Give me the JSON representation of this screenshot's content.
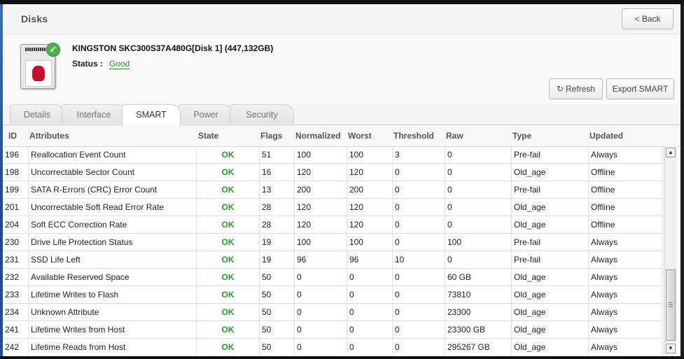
{
  "header": {
    "title": "Disks",
    "back_label": "< Back"
  },
  "disk": {
    "name": "KINGSTON SKC300S37A480G[Disk 1] (447,132GB)",
    "status_label": "Status :",
    "status_value": "Good",
    "status_color": "#2d8a2d"
  },
  "actions": {
    "refresh_label": "Refresh",
    "export_label": "Export SMART"
  },
  "tabs": [
    {
      "label": "Details",
      "active": false
    },
    {
      "label": "Interface",
      "active": false
    },
    {
      "label": "SMART",
      "active": true
    },
    {
      "label": "Power",
      "active": false
    },
    {
      "label": "Security",
      "active": false
    }
  ],
  "table": {
    "columns": [
      "ID",
      "Attributes",
      "State",
      "Flags",
      "Normalized",
      "Worst",
      "Threshold",
      "Raw",
      "Type",
      "Updated"
    ],
    "rows": [
      [
        "196",
        "Reallocation Event Count",
        "OK",
        "51",
        "100",
        "100",
        "3",
        "0",
        "Pre-fail",
        "Always"
      ],
      [
        "198",
        "Uncorrectable Sector Count",
        "OK",
        "16",
        "120",
        "120",
        "0",
        "0",
        "Old_age",
        "Offline"
      ],
      [
        "199",
        "SATA R-Errors (CRC) Error Count",
        "OK",
        "13",
        "200",
        "200",
        "0",
        "0",
        "Pre-fail",
        "Offline"
      ],
      [
        "201",
        "Uncorrectable Soft Read Error Rate",
        "OK",
        "28",
        "120",
        "120",
        "0",
        "0",
        "Old_age",
        "Offline"
      ],
      [
        "204",
        "Soft ECC Correction Rate",
        "OK",
        "28",
        "120",
        "120",
        "0",
        "0",
        "Old_age",
        "Offline"
      ],
      [
        "230",
        "Drive Life Protection Status",
        "OK",
        "19",
        "100",
        "100",
        "0",
        "100",
        "Pre-fail",
        "Always"
      ],
      [
        "231",
        "SSD Life Left",
        "OK",
        "19",
        "96",
        "96",
        "10",
        "0",
        "Pre-fail",
        "Always"
      ],
      [
        "232",
        "Available Reserved Space",
        "OK",
        "50",
        "0",
        "0",
        "0",
        "60 GB",
        "Old_age",
        "Always"
      ],
      [
        "233",
        "Lifetime Writes to Flash",
        "OK",
        "50",
        "0",
        "0",
        "0",
        "73810",
        "Old_age",
        "Always"
      ],
      [
        "234",
        "Unknown Attribute",
        "OK",
        "50",
        "0",
        "0",
        "0",
        "23300",
        "Old_age",
        "Always"
      ],
      [
        "241",
        "Lifetime Writes from Host",
        "OK",
        "50",
        "0",
        "0",
        "0",
        "23300 GB",
        "Old_age",
        "Always"
      ],
      [
        "242",
        "Lifetime Reads from Host",
        "OK",
        "50",
        "0",
        "0",
        "0",
        "295267 GB",
        "Old_age",
        "Always"
      ]
    ]
  },
  "icons": {
    "disk": "disk-drive-icon",
    "status": "check-icon",
    "refresh": "refresh-icon"
  }
}
